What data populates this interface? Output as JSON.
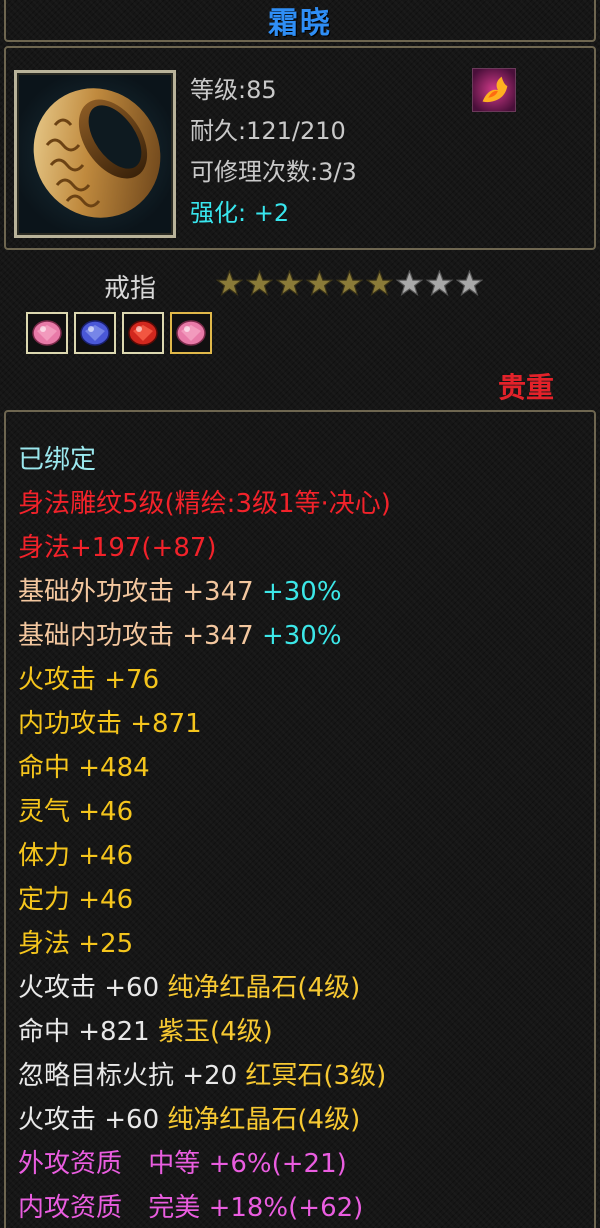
{
  "item": {
    "name": "霜晓",
    "level_text": "等级:85",
    "durability_text": "耐久:121/210",
    "repair_text": "可修理次数:3/3",
    "enhance_label": "强化:",
    "enhance_value": "+2",
    "type": "戒指",
    "rarity": "贵重",
    "icon": "gold-swirl-ring-icon",
    "skill_icon": "flame-phoenix-icon"
  },
  "stars": {
    "filled": 6,
    "total": 9
  },
  "gems": [
    "pink-gem-icon",
    "blue-gem-icon",
    "red-gem-icon",
    "pink-gem-icon"
  ],
  "attributes": [
    {
      "text": "已绑定",
      "color": "#9be8ee"
    },
    {
      "text": "身法雕纹5级(精绘:3级1等·决心)",
      "color": "#f2222a"
    },
    {
      "text": "身法+197(+87)",
      "color": "#f2222a"
    },
    {
      "text": "基础外功攻击 +347",
      "extra": "+30%",
      "color": "#f3c79f"
    },
    {
      "text": "基础内功攻击 +347",
      "extra": "+30%",
      "color": "#f3c79f"
    },
    {
      "text": "火攻击 +76",
      "color": "#f5c51c"
    },
    {
      "text": "内功攻击 +871",
      "color": "#f5c51c"
    },
    {
      "text": "命中 +484",
      "color": "#f5c51c"
    },
    {
      "text": "灵气 +46",
      "color": "#f5c51c"
    },
    {
      "text": "体力 +46",
      "color": "#f5c51c"
    },
    {
      "text": "定力 +46",
      "color": "#f5c51c"
    },
    {
      "text": "身法 +25",
      "color": "#f5c51c"
    }
  ],
  "gem_attributes": [
    {
      "stat": "火攻击 +60",
      "gem": "纯净红晶石(4级)"
    },
    {
      "stat": "命中 +821",
      "gem": "紫玉(4级)"
    },
    {
      "stat": "忽略目标火抗 +20",
      "gem": "红冥石(3级)"
    },
    {
      "stat": "火攻击 +60",
      "gem": "纯净红晶石(4级)"
    }
  ],
  "aptitudes": [
    {
      "label": "外攻资质",
      "grade": "中等",
      "value": "+6%(+21)"
    },
    {
      "label": "内攻资质",
      "grade": "完美",
      "value": "+18%(+62)"
    }
  ]
}
